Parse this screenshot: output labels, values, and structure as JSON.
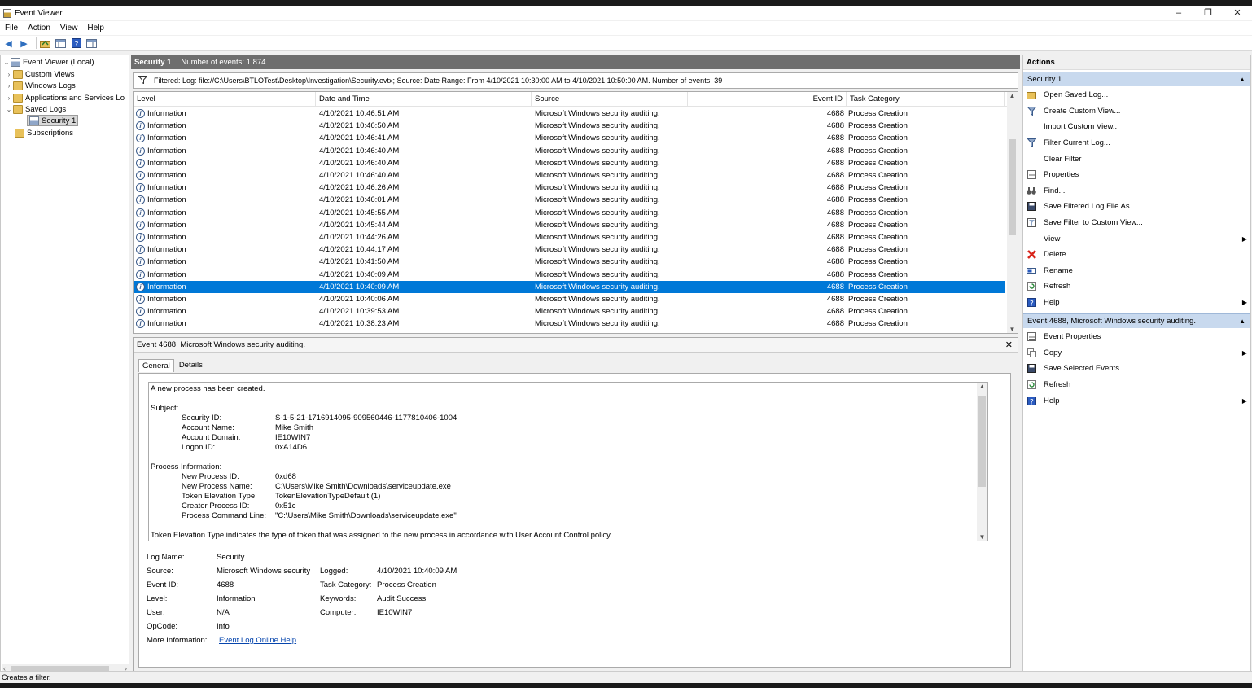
{
  "window": {
    "title": "Event Viewer",
    "minimize": "–",
    "restore": "❐",
    "close": "✕"
  },
  "menu": [
    "File",
    "Action",
    "View",
    "Help"
  ],
  "tree": {
    "root": "Event Viewer (Local)",
    "items": [
      {
        "label": "Custom Views"
      },
      {
        "label": "Windows Logs"
      },
      {
        "label": "Applications and Services Lo"
      },
      {
        "label": "Saved Logs"
      },
      {
        "label": "Security 1"
      },
      {
        "label": "Subscriptions"
      }
    ]
  },
  "main": {
    "log_name": "Security 1",
    "event_count": "Number of events: 1,874",
    "filter_text": "Filtered: Log: file://C:\\Users\\BTLOTest\\Desktop\\Investigation\\Security.evtx; Source: Date Range: From 4/10/2021 10:30:00 AM to 4/10/2021 10:50:00 AM. Number of events: 39",
    "columns": [
      "Level",
      "Date and Time",
      "Source",
      "Event ID",
      "Task Category"
    ],
    "rows": [
      {
        "level": "Information",
        "date": "4/10/2021 10:46:51 AM",
        "source": "Microsoft Windows security auditing.",
        "id": "4688",
        "task": "Process Creation"
      },
      {
        "level": "Information",
        "date": "4/10/2021 10:46:50 AM",
        "source": "Microsoft Windows security auditing.",
        "id": "4688",
        "task": "Process Creation"
      },
      {
        "level": "Information",
        "date": "4/10/2021 10:46:41 AM",
        "source": "Microsoft Windows security auditing.",
        "id": "4688",
        "task": "Process Creation"
      },
      {
        "level": "Information",
        "date": "4/10/2021 10:46:40 AM",
        "source": "Microsoft Windows security auditing.",
        "id": "4688",
        "task": "Process Creation"
      },
      {
        "level": "Information",
        "date": "4/10/2021 10:46:40 AM",
        "source": "Microsoft Windows security auditing.",
        "id": "4688",
        "task": "Process Creation"
      },
      {
        "level": "Information",
        "date": "4/10/2021 10:46:40 AM",
        "source": "Microsoft Windows security auditing.",
        "id": "4688",
        "task": "Process Creation"
      },
      {
        "level": "Information",
        "date": "4/10/2021 10:46:26 AM",
        "source": "Microsoft Windows security auditing.",
        "id": "4688",
        "task": "Process Creation"
      },
      {
        "level": "Information",
        "date": "4/10/2021 10:46:01 AM",
        "source": "Microsoft Windows security auditing.",
        "id": "4688",
        "task": "Process Creation"
      },
      {
        "level": "Information",
        "date": "4/10/2021 10:45:55 AM",
        "source": "Microsoft Windows security auditing.",
        "id": "4688",
        "task": "Process Creation"
      },
      {
        "level": "Information",
        "date": "4/10/2021 10:45:44 AM",
        "source": "Microsoft Windows security auditing.",
        "id": "4688",
        "task": "Process Creation"
      },
      {
        "level": "Information",
        "date": "4/10/2021 10:44:26 AM",
        "source": "Microsoft Windows security auditing.",
        "id": "4688",
        "task": "Process Creation"
      },
      {
        "level": "Information",
        "date": "4/10/2021 10:44:17 AM",
        "source": "Microsoft Windows security auditing.",
        "id": "4688",
        "task": "Process Creation"
      },
      {
        "level": "Information",
        "date": "4/10/2021 10:41:50 AM",
        "source": "Microsoft Windows security auditing.",
        "id": "4688",
        "task": "Process Creation"
      },
      {
        "level": "Information",
        "date": "4/10/2021 10:40:09 AM",
        "source": "Microsoft Windows security auditing.",
        "id": "4688",
        "task": "Process Creation"
      },
      {
        "level": "Information",
        "date": "4/10/2021 10:40:09 AM",
        "source": "Microsoft Windows security auditing.",
        "id": "4688",
        "task": "Process Creation",
        "selected": true
      },
      {
        "level": "Information",
        "date": "4/10/2021 10:40:06 AM",
        "source": "Microsoft Windows security auditing.",
        "id": "4688",
        "task": "Process Creation"
      },
      {
        "level": "Information",
        "date": "4/10/2021 10:39:53 AM",
        "source": "Microsoft Windows security auditing.",
        "id": "4688",
        "task": "Process Creation"
      },
      {
        "level": "Information",
        "date": "4/10/2021 10:38:23 AM",
        "source": "Microsoft Windows security auditing.",
        "id": "4688",
        "task": "Process Creation"
      }
    ]
  },
  "details": {
    "title": "Event 4688, Microsoft Windows security auditing.",
    "tabs": [
      "General",
      "Details"
    ],
    "desc": {
      "intro": "A new process has been created.",
      "subject": "Subject:",
      "subject_fields": [
        [
          "Security ID:",
          "S-1-5-21-1716914095-909560446-1177810406-1004"
        ],
        [
          "Account Name:",
          "Mike Smith"
        ],
        [
          "Account Domain:",
          "IE10WIN7"
        ],
        [
          "Logon ID:",
          "0xA14D6"
        ]
      ],
      "process": "Process Information:",
      "process_fields": [
        [
          "New Process ID:",
          "0xd68"
        ],
        [
          "New Process Name:",
          "C:\\Users\\Mike Smith\\Downloads\\serviceupdate.exe"
        ],
        [
          "Token Elevation Type:",
          "TokenElevationTypeDefault (1)"
        ],
        [
          "Creator Process ID:",
          "0x51c"
        ],
        [
          "Process Command Line:",
          "\"C:\\Users\\Mike Smith\\Downloads\\serviceupdate.exe\""
        ]
      ],
      "footer": "Token Elevation Type indicates the type of token that was assigned to the new process in accordance with User Account Control policy."
    },
    "meta": {
      "log_name_label": "Log Name:",
      "log_name": "Security",
      "source_label": "Source:",
      "source": "Microsoft Windows security",
      "logged_label": "Logged:",
      "logged": "4/10/2021 10:40:09 AM",
      "event_id_label": "Event ID:",
      "event_id": "4688",
      "task_label": "Task Category:",
      "task": "Process Creation",
      "level_label": "Level:",
      "level": "Information",
      "keywords_label": "Keywords:",
      "keywords": "Audit Success",
      "user_label": "User:",
      "user": "N/A",
      "computer_label": "Computer:",
      "computer": "IE10WIN7",
      "opcode_label": "OpCode:",
      "opcode": "Info",
      "more_label": "More Information:",
      "more_link": "Event Log Online Help"
    }
  },
  "actions": {
    "header": "Actions",
    "section1": "Security 1",
    "items1": [
      {
        "label": "Open Saved Log...",
        "icon": "folder-open-icon"
      },
      {
        "label": "Create Custom View...",
        "icon": "funnel-icon"
      },
      {
        "label": "Import Custom View...",
        "icon": ""
      },
      {
        "label": "Filter Current Log...",
        "icon": "funnel-icon"
      },
      {
        "label": "Clear Filter",
        "icon": ""
      },
      {
        "label": "Properties",
        "icon": "properties-icon"
      },
      {
        "label": "Find...",
        "icon": "binoculars-icon"
      },
      {
        "label": "Save Filtered Log File As...",
        "icon": "save-icon"
      },
      {
        "label": "Save Filter to Custom View...",
        "icon": "save-filter-icon"
      },
      {
        "label": "View",
        "icon": "",
        "sub": true
      },
      {
        "label": "Delete",
        "icon": "delete-icon"
      },
      {
        "label": "Rename",
        "icon": "rename-icon"
      },
      {
        "label": "Refresh",
        "icon": "refresh-icon"
      },
      {
        "label": "Help",
        "icon": "help-icon",
        "sub": true
      }
    ],
    "section2": "Event 4688, Microsoft Windows security auditing.",
    "items2": [
      {
        "label": "Event Properties",
        "icon": "properties-icon"
      },
      {
        "label": "Copy",
        "icon": "copy-icon",
        "sub": true
      },
      {
        "label": "Save Selected Events...",
        "icon": "save-icon"
      },
      {
        "label": "Refresh",
        "icon": "refresh-icon"
      },
      {
        "label": "Help",
        "icon": "help-icon",
        "sub": true
      }
    ]
  },
  "status": "Creates a filter.",
  "colors": {
    "selection": "#0078d7",
    "header_gray": "#6e6e6e",
    "section_blue": "#c8d9ee",
    "delete_red": "#d9261c"
  }
}
